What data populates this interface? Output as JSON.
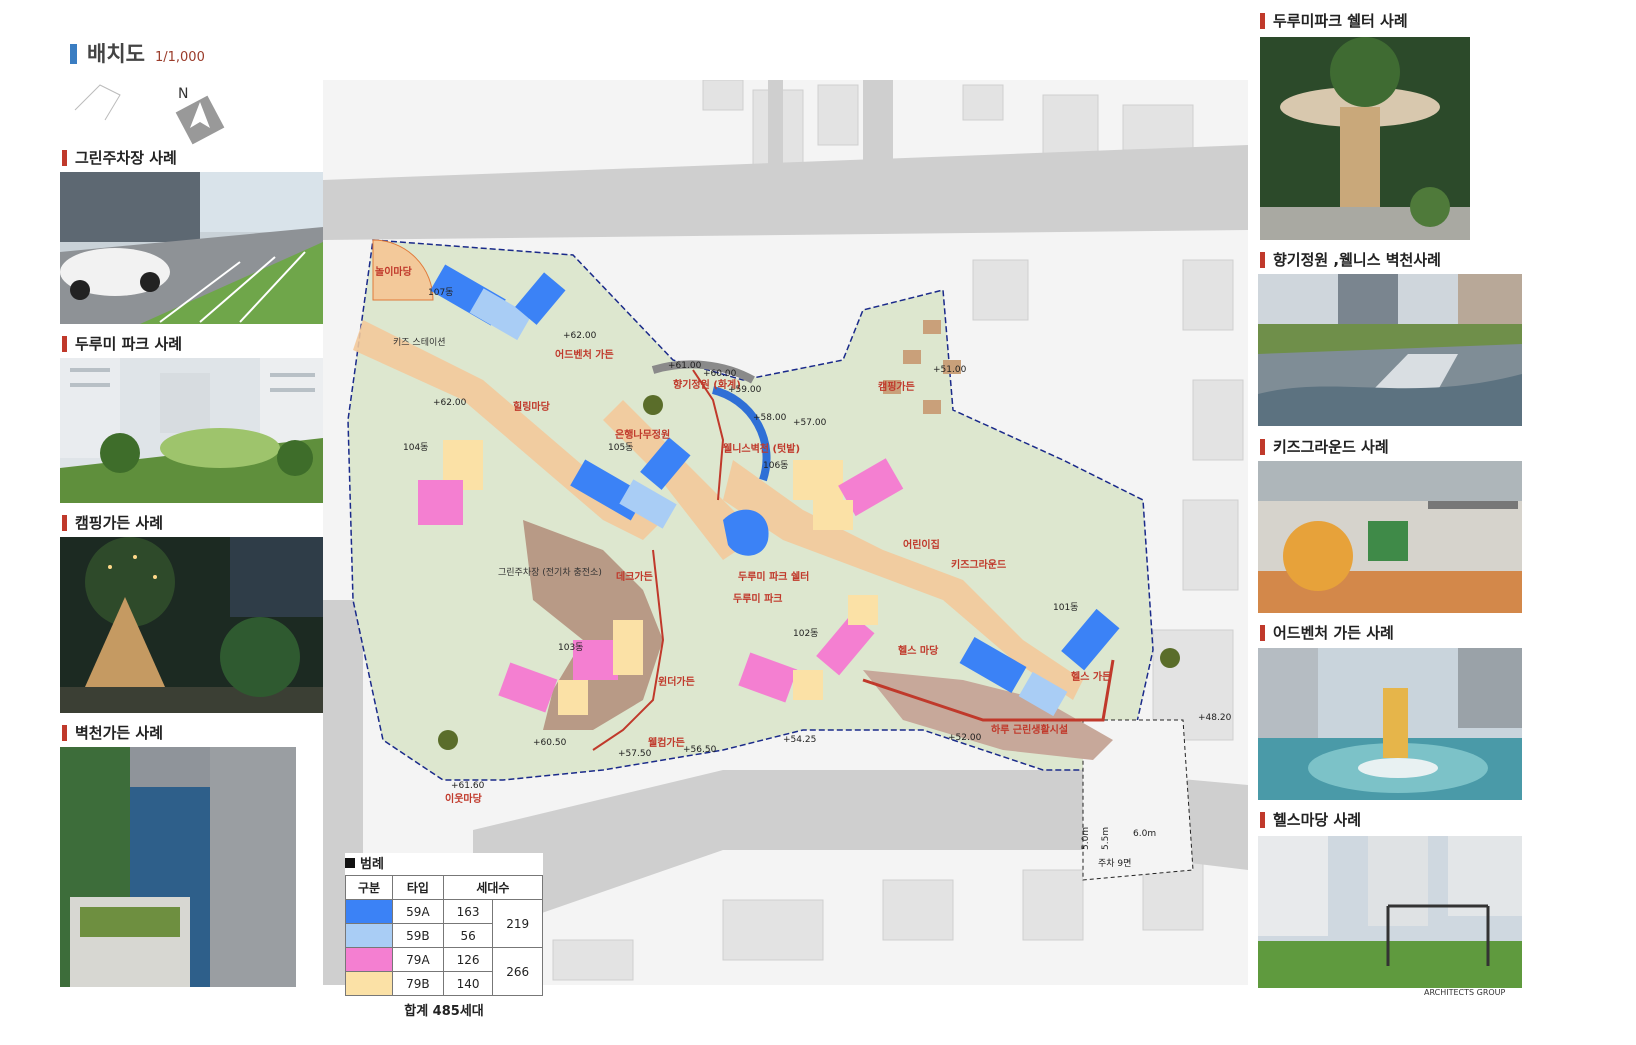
{
  "header": {
    "title": "배치도",
    "scale": "1/1,000"
  },
  "compass": {
    "label": "N"
  },
  "captions": {
    "green_parking": "그린주차장 사례",
    "durumi_park": "두루미 파크 사례",
    "camping_garden": "캠핑가든 사례",
    "wall_garden": "벽천가든 사례",
    "shelter": "두루미파크 쉘터 사례",
    "fragrance": "향기정원 ,웰니스 벽천사례",
    "kids_ground": "키즈그라운드 사례",
    "adventure": "어드벤처 가든 사례",
    "health": "헬스마당 사례"
  },
  "map_labels": {
    "play": "놀이마당",
    "adventure": "어드벤처 가든",
    "healing": "힐링마당",
    "ginkgo": "은행나무정원",
    "fragrance": "향기정원\n(화계)",
    "wellness": "웰니스벽천\n(텃밭)",
    "camping": "캠핑가든",
    "daycare": "어린이집",
    "kids": "키즈그라운드",
    "deck": "데크가든",
    "shelter": "두루미 파크 쉘터",
    "durumi": "두루미\n파크",
    "health": "헬스 마당",
    "summer": "하루 근린생활시설",
    "healthgarden": "헬스\n가든",
    "windergarden": "윈더가든",
    "welcome": "웰컴가든",
    "neighbor": "이웃마당",
    "kidsstage": "키즈 스테이션",
    "greenparking": "그린주차장\n(전기차 충전소)"
  },
  "buildings": [
    "107동",
    "105동",
    "106동",
    "104동",
    "103동",
    "102동",
    "101동"
  ],
  "levels": [
    "+62.00",
    "+61.00",
    "+60.00",
    "+59.00",
    "+58.00",
    "+57.00",
    "+56.50",
    "+57.50",
    "+54.25",
    "+52.00",
    "+51.00",
    "+48.20",
    "+61.60",
    "+62.00",
    "+60.50"
  ],
  "parking": {
    "w1": "5.0m",
    "w2": "5.5m",
    "w3": "6.0m",
    "count": "주차 9면"
  },
  "legend": {
    "title": "범례",
    "headers": [
      "구분",
      "타입",
      "세대수"
    ],
    "rows": [
      {
        "type": "59A",
        "count": "163",
        "color": "#3b82f6"
      },
      {
        "type": "59B",
        "count": "56",
        "color": "#a9cdf5"
      },
      {
        "type": "79A",
        "count": "126",
        "color": "#f47fd1"
      },
      {
        "type": "79B",
        "count": "140",
        "color": "#fbe1a6"
      }
    ],
    "group1_total": "219",
    "group2_total": "266",
    "total": "합계 485세대"
  },
  "footer": {
    "brand": "ARCHITECTS GROUP"
  }
}
